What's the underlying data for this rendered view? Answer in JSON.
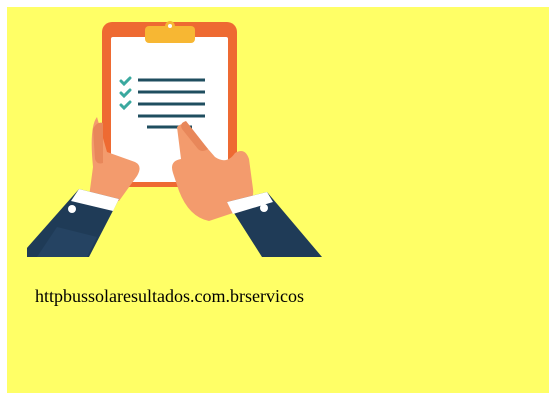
{
  "content": {
    "url_text": "httpbussolaresultados.com.brservicos"
  },
  "illustration": {
    "icon": "clipboard-checklist-icon",
    "colors": {
      "background": "#ffff66",
      "clipboard": "#ee6a32",
      "clip": "#f7b733",
      "paper": "#ffffff",
      "lines": "#1f4e5f",
      "checkmarks": "#3aa99f",
      "skin": "#f39b6d",
      "sleeve": "#1f3b57",
      "cuff": "#ffffff"
    }
  }
}
